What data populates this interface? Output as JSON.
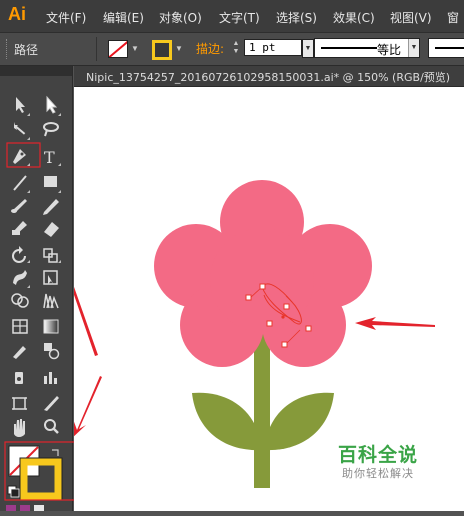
{
  "app": {
    "logo": "Ai"
  },
  "menu": {
    "items": [
      "文件(F)",
      "编辑(E)",
      "对象(O)",
      "文字(T)",
      "选择(S)",
      "效果(C)",
      "视图(V)",
      "窗"
    ]
  },
  "control_bar": {
    "title": "路径",
    "stroke_label": "描边:",
    "stroke_weight": "1 pt",
    "profile_label": "等比"
  },
  "document": {
    "tab_title": "Nipic_13754257_20160726102958150031.ai*  @  150%  (RGB/预览)"
  },
  "colors": {
    "petal": "#f36a85",
    "leaf": "#869a3a",
    "stem": "#869a3a",
    "anchor_selection": "#e8352a",
    "annotation_arrow": "#e3232c",
    "stroke_swatch": "#f7c81d",
    "app_logo": "#ff9a00"
  },
  "watermark": {
    "title": "百科全说",
    "subtitle": "助你轻松解决"
  },
  "icons": {
    "tools": [
      "selection-tool-icon",
      "direct-selection-tool-icon",
      "magic-wand-icon",
      "lasso-icon",
      "pen-tool-icon",
      "type-tool-icon",
      "line-tool-icon",
      "rectangle-tool-icon",
      "paintbrush-icon",
      "pencil-icon",
      "blob-brush-icon",
      "eraser-icon",
      "rotate-icon",
      "scale-icon",
      "warp-icon",
      "free-transform-icon",
      "shape-builder-icon",
      "perspective-grid-icon",
      "mesh-icon",
      "gradient-icon",
      "eyedropper-icon",
      "blend-icon",
      "symbol-sprayer-icon",
      "column-graph-icon",
      "artboard-icon",
      "slice-icon",
      "hand-icon",
      "zoom-icon"
    ]
  }
}
